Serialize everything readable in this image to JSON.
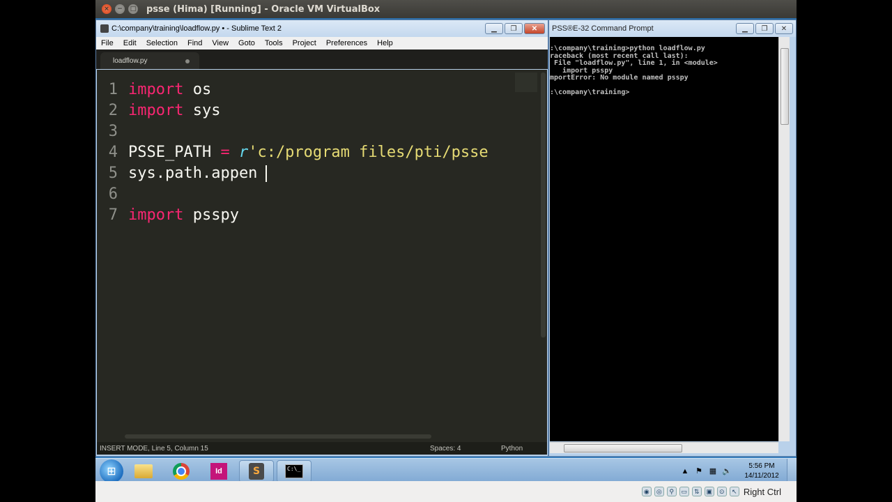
{
  "vbox": {
    "title": "psse (Hima) [Running] - Oracle VM VirtualBox",
    "host_key": "Right Ctrl"
  },
  "sublime": {
    "title": "C:\\company\\training\\loadflow.py • - Sublime Text 2",
    "menu": [
      "File",
      "Edit",
      "Selection",
      "Find",
      "View",
      "Goto",
      "Tools",
      "Project",
      "Preferences",
      "Help"
    ],
    "tab": "loadflow.py",
    "line_numbers": [
      "1",
      "2",
      "3",
      "4",
      "5",
      "6",
      "7"
    ],
    "code": {
      "l1_kw": "import",
      "l1_rest": " os",
      "l2_kw": "import",
      "l2_rest": " sys",
      "l4_name": "PSSE_PATH ",
      "l4_op": "=",
      "l4_prefix": " r",
      "l4_str": "'c:/program files/pti/psse",
      "l5": "sys.path.appen",
      "l7_kw": "import",
      "l7_rest": " psspy"
    },
    "status": {
      "left": "INSERT MODE, Line 5, Column 15",
      "spaces": "Spaces: 4",
      "language": "Python"
    }
  },
  "cmd": {
    "title": "PSS®E-32 Command Prompt",
    "output": ":\\company\\training>python loadflow.py\nraceback (most recent call last):\n File \"loadflow.py\", line 1, in <module>\n   import psspy\nmportError: No module named psspy\n\n:\\company\\training>"
  },
  "taskbar": {
    "time": "5:56 PM",
    "date": "14/11/2012"
  },
  "colors": {
    "keyword": "#f92672",
    "string": "#e6db74",
    "storage": "#66d9ef",
    "editor_bg": "#272822"
  }
}
